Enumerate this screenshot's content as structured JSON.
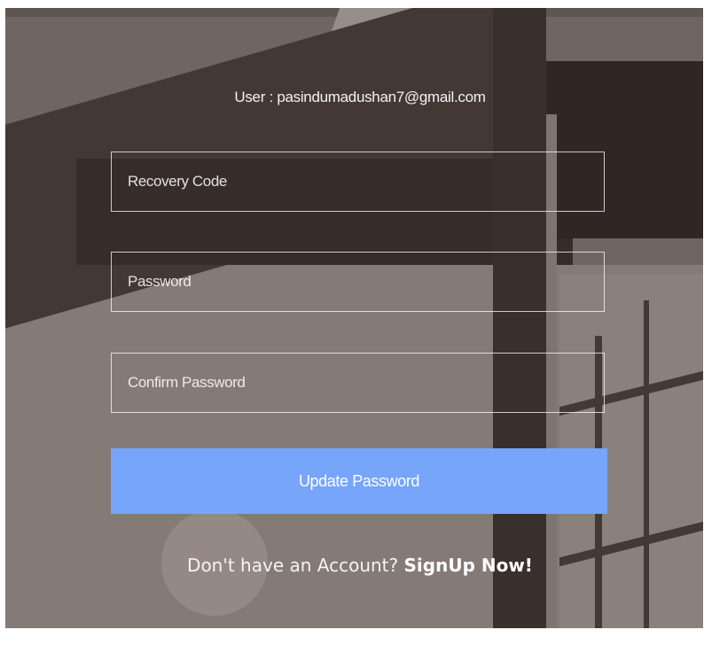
{
  "user": {
    "label": "User : pasindumadushan7@gmail.com"
  },
  "form": {
    "recovery_code_placeholder": "Recovery Code",
    "password_placeholder": "Password",
    "confirm_password_placeholder": "Confirm Password",
    "recovery_code_value": "",
    "password_value": "",
    "confirm_password_value": "",
    "submit_label": "Update Password"
  },
  "footer": {
    "prompt": "Don't have an Account?",
    "link_label": "SignUp Now!"
  },
  "colors": {
    "button": "#76a5fa",
    "text": "#ffffff"
  }
}
